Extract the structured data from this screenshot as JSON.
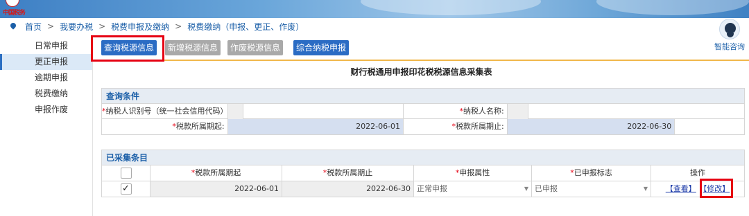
{
  "logo": {
    "text": "中国税务"
  },
  "breadcrumb": [
    "首页",
    "我要办税",
    "税费申报及缴纳",
    "税费缴纳（申报、更正、作废）"
  ],
  "breadcrumb_separator": ">",
  "consult": {
    "label": "智能咨询"
  },
  "sidebar": {
    "items": [
      {
        "label": "日常申报",
        "active": false
      },
      {
        "label": "更正申报",
        "active": true
      },
      {
        "label": "逾期申报",
        "active": false
      },
      {
        "label": "税费缴纳",
        "active": false
      },
      {
        "label": "申报作废",
        "active": false
      }
    ]
  },
  "toolbar": {
    "query_label": "查询税源信息",
    "add_label": "新增税源信息",
    "void_label": "作废税源信息",
    "combined_label": "综合纳税申报"
  },
  "form_title": "财行税通用申报印花税税源信息采集表",
  "query": {
    "heading": "查询条件",
    "taxpayer_id_label": "纳税人识别号（统一社会信用代码）:",
    "taxpayer_id_value": "",
    "taxpayer_name_label": "纳税人名称:",
    "taxpayer_name_value": "",
    "period_start_label": "税款所属期起:",
    "period_start_value": "2022-06-01",
    "period_end_label": "税款所属期止:",
    "period_end_value": "2022-06-30",
    "required_mark": "*"
  },
  "collected": {
    "heading": "已采集条目",
    "columns": [
      "税款所属期起",
      "税款所属期止",
      "申报属性",
      "已申报标志",
      "操作"
    ],
    "rows": [
      {
        "checked": true,
        "check_glyph": "✓",
        "period_start": "2022-06-01",
        "period_end": "2022-06-30",
        "attribute": "正常申报",
        "status": "已申报",
        "view_label": "【查看】",
        "edit_label": "【修改】"
      }
    ]
  },
  "colors": {
    "accent": "#2b6cc4",
    "highlight": "#e60012",
    "toolbar_rule": "#f1b84b"
  }
}
